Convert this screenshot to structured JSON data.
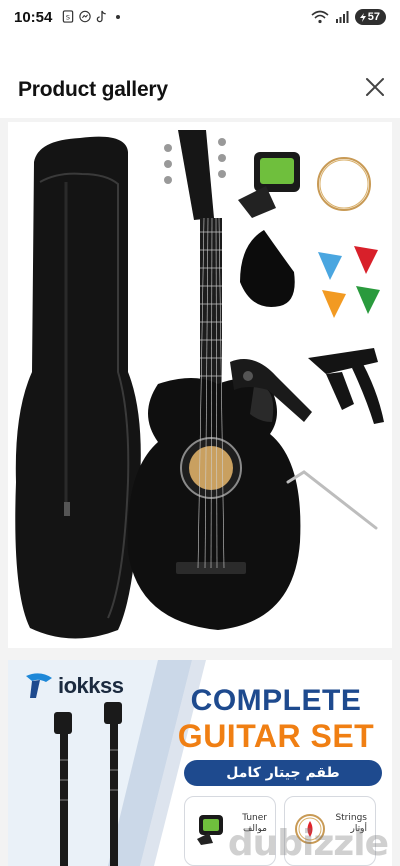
{
  "status_bar": {
    "time": "10:54",
    "battery": "57",
    "icons_left": [
      "sim-icon",
      "messenger-icon",
      "tiktok-icon"
    ],
    "icons_right": [
      "wifi-icon",
      "signal-icon",
      "battery-icon"
    ]
  },
  "header": {
    "title": "Product gallery",
    "close_icon": "close-icon"
  },
  "gallery": {
    "images": [
      {
        "kind": "product-photo",
        "contents": [
          "guitar-gig-bag",
          "black-acoustic-guitar",
          "clip-on-tuner",
          "spare-strings",
          "pickguard",
          "guitar-picks",
          "guitar-strap",
          "capo",
          "allen-wrench"
        ]
      },
      {
        "kind": "banner",
        "brand": "iokkss",
        "heading_line1": "COMPLETE",
        "heading_line2": "GUITAR SET",
        "arabic_subtitle": "طقم جيتار كامل",
        "features": [
          {
            "label_en": "Tuner",
            "label_ar": "موالف"
          },
          {
            "label_en": "Strings",
            "label_ar": "أوتار"
          }
        ]
      }
    ],
    "watermark": "dubizzle"
  },
  "colors": {
    "brand_blue": "#1e4a8e",
    "brand_orange": "#f07f13",
    "background": "#f3f3f3"
  }
}
